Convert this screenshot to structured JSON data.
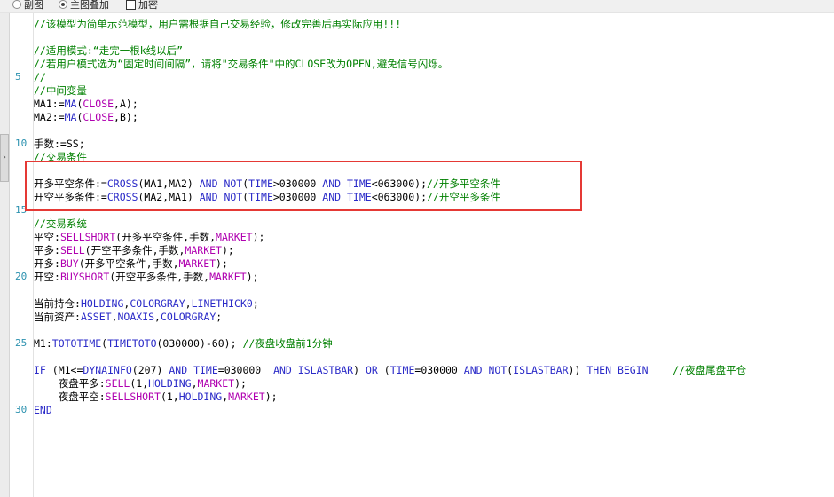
{
  "toolbar": {
    "option_subchart": "副图",
    "option_overlay": "主图叠加",
    "option_encrypt": "加密"
  },
  "gutter_numbers": [
    "5",
    "10",
    "15",
    "20",
    "25",
    "30"
  ],
  "code": {
    "l1": "//该模型为简单示范模型，用户需根据自己交易经验，修改完善后再实际应用!!!",
    "l3": "//适用模式:“走完一根k线以后”",
    "l4": "//若用户模式选为“固定时间间隔”，请将\"交易条件\"中的CLOSE改为OPEN,避免信号闪烁。",
    "l5": "//",
    "l6": "//中间变量",
    "l7": {
      "a": "MA1:=",
      "b": "MA",
      "c": "(",
      "d": "CLOSE",
      "e": ",A);"
    },
    "l8": {
      "a": "MA2:=",
      "b": "MA",
      "c": "(",
      "d": "CLOSE",
      "e": ",B);"
    },
    "l10": "手数:=SS;",
    "l11": "//交易条件",
    "l13": {
      "name": "开多平空条件:=",
      "f1": "CROSS",
      "a1": "(MA1,MA2) ",
      "k1": "AND",
      "s1": " ",
      "f2": "NOT",
      "a2": "(",
      "t1": "TIME",
      "a3": ">030000 ",
      "k2": "AND",
      "s2": " ",
      "t2": "TIME",
      "a4": "<063000);",
      "cm": "//开多平空条件"
    },
    "l14": {
      "name": "开空平多条件:=",
      "f1": "CROSS",
      "a1": "(MA2,MA1) ",
      "k1": "AND",
      "s1": " ",
      "f2": "NOT",
      "a2": "(",
      "t1": "TIME",
      "a3": ">030000 ",
      "k2": "AND",
      "s2": " ",
      "t2": "TIME",
      "a4": "<063000);",
      "cm": "//开空平多条件"
    },
    "l16": "//交易系统",
    "l17": {
      "a": "平空:",
      "f": "SELLSHORT",
      "b": "(开多平空条件,手数,",
      "m": "MARKET",
      "c": ");"
    },
    "l18": {
      "a": "平多:",
      "f": "SELL",
      "b": "(开空平多条件,手数,",
      "m": "MARKET",
      "c": ");"
    },
    "l19": {
      "a": "开多:",
      "f": "BUY",
      "b": "(开多平空条件,手数,",
      "m": "MARKET",
      "c": ");"
    },
    "l20": {
      "a": "开空:",
      "f": "BUYSHORT",
      "b": "(开空平多条件,手数,",
      "m": "MARKET",
      "c": ");"
    },
    "l22": {
      "a": "当前持仓:",
      "f1": "HOLDING",
      "s1": ",",
      "f2": "COLORGRAY",
      "s2": ",",
      "f3": "LINETHICK0",
      "c": ";"
    },
    "l23": {
      "a": "当前资产:",
      "f1": "ASSET",
      "s1": ",",
      "f2": "NOAXIS",
      "s2": ",",
      "f3": "COLORGRAY",
      "c": ";"
    },
    "l25": {
      "a": "M1:",
      "f1": "TOTOTIME",
      "b": "(",
      "f2": "TIMETOTO",
      "c": "(030000)-60); ",
      "cm": "//夜盘收盘前1分钟"
    },
    "l27": {
      "if": "IF",
      "p1": " (M1<=",
      "f1": "DYNAINFO",
      "p2": "(207) ",
      "and1": "AND",
      "p3": " ",
      "t1": "TIME",
      "p4": "=030000  ",
      "and2": "AND",
      "p5": " ",
      "f2": "ISLASTBAR",
      "p6": ") ",
      "or": "OR",
      "p7": " (",
      "t2": "TIME",
      "p8": "=030000 ",
      "and3": "AND",
      "p9": " ",
      "f3": "NOT",
      "p10": "(",
      "f4": "ISLASTBAR",
      "p11": ")) ",
      "then": "THEN",
      "p12": " ",
      "begin": "BEGIN",
      "p13": "    ",
      "cm": "//夜盘尾盘平仓"
    },
    "l28": {
      "ind": "    ",
      "a": "夜盘平多:",
      "f": "SELL",
      "b": "(1,",
      "f2": "HOLDING",
      "c": ",",
      "m": "MARKET",
      "d": ");"
    },
    "l29": {
      "ind": "    ",
      "a": "夜盘平空:",
      "f": "SELLSHORT",
      "b": "(1,",
      "f2": "HOLDING",
      "c": ",",
      "m": "MARKET",
      "d": ");"
    },
    "l30": "END"
  }
}
